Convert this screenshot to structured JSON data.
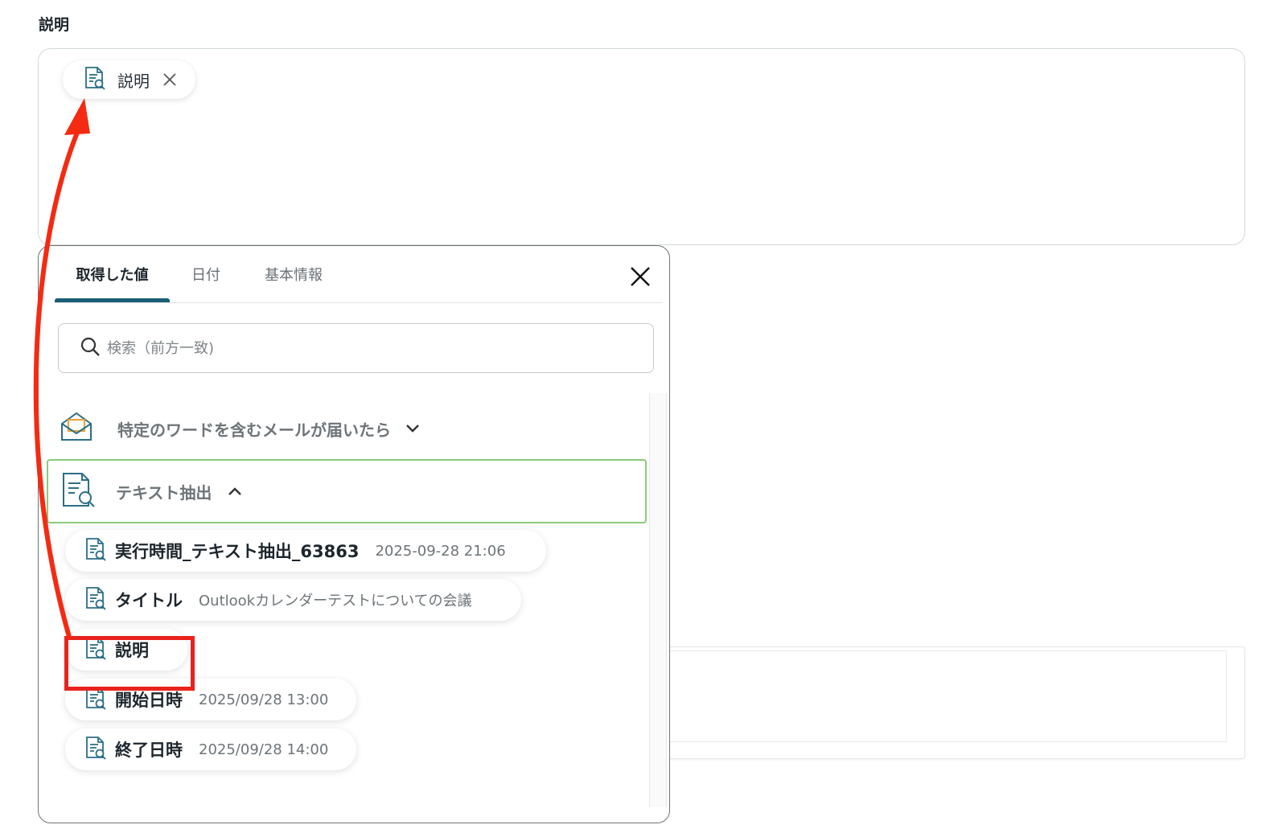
{
  "field": {
    "label": "説明",
    "chip_label": "説明"
  },
  "popup": {
    "tabs": [
      {
        "label": "取得した値",
        "active": true
      },
      {
        "label": "日付",
        "active": false
      },
      {
        "label": "基本情報",
        "active": false
      }
    ],
    "search_placeholder": "検索（前方一致)",
    "groups": [
      {
        "label": "特定のワードを含むメールが届いたら",
        "expanded": false,
        "icon": "mail-icon"
      },
      {
        "label": "テキスト抽出",
        "expanded": true,
        "icon": "document-search-icon"
      }
    ],
    "items": [
      {
        "name": "実行時間_テキスト抽出_63863",
        "value": "2025-09-28 21:06"
      },
      {
        "name": "タイトル",
        "value": "Outlookカレンダーテストについての会議"
      },
      {
        "name": "説明",
        "value": ""
      },
      {
        "name": "開始日時",
        "value": "2025/09/28 13:00"
      },
      {
        "name": "終了日時",
        "value": "2025/09/28 14:00"
      }
    ]
  },
  "colors": {
    "accent": "#1a5e75",
    "highlight": "#e8231c",
    "group_border": "#8cca7c",
    "icon": "#2b6e86"
  }
}
